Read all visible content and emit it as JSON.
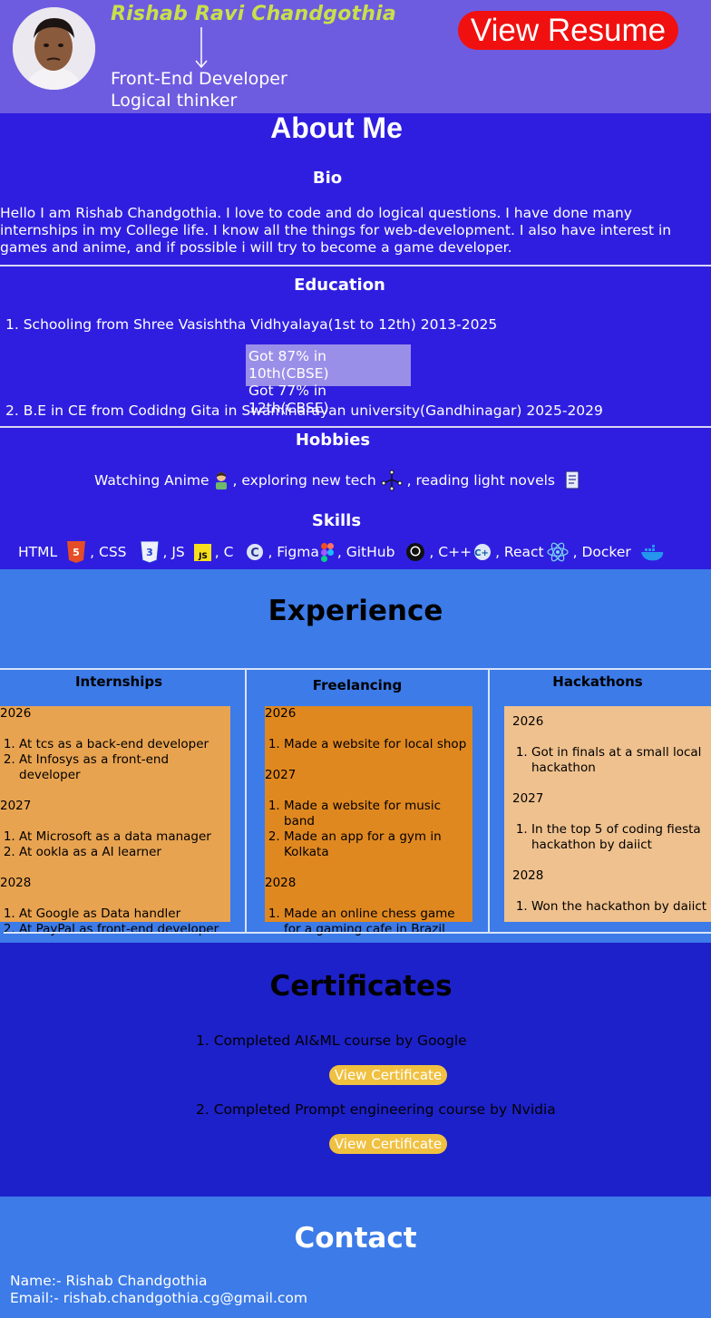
{
  "header": {
    "name": "Rishab Ravi Chandgothia",
    "roles": [
      "Front-End Developer",
      "Logical thinker"
    ],
    "resume_button": "View Resume"
  },
  "about": {
    "title": "About Me",
    "bio_heading": "Bio",
    "bio_text": "Hello I am Rishab Chandgothia. I love to code and do logical questions. I have done many internships in my College life. I know all the things for web-development. I also have interest in games and anime, and if possible i will try to become a game developer.",
    "education_heading": "Education",
    "education": [
      "1. Schooling from Shree Vasishtha Vidhyalaya(1st to 12th) 2013-2025",
      "2. B.E in CE from Codidng Gita in Swaminarayan university(Gandhinagar) 2025-2029"
    ],
    "grades": [
      "Got 87% in 10th(CBSE)",
      "Got 77% in 12th(CBSE)"
    ],
    "hobbies_heading": "Hobbies",
    "hobbies": [
      "Watching Anime",
      ", exploring new tech",
      ", reading light novels"
    ],
    "skills_heading": "Skills",
    "skills": [
      "HTML",
      ", CSS",
      ", JS",
      ", C",
      ", Figma",
      ", GitHub",
      ", C++",
      ", React",
      ", Docker"
    ]
  },
  "experience": {
    "title": "Experience",
    "internships": {
      "heading": "Internships",
      "years": [
        {
          "year": "2026",
          "items": [
            "At tcs as a back-end developer",
            "At Infosys as a front-end developer"
          ]
        },
        {
          "year": "2027",
          "items": [
            "At Microsoft as a data manager",
            "At ookla as a AI learner"
          ]
        },
        {
          "year": "2028",
          "items": [
            "At Google as Data handler",
            "At PayPal as front-end developer"
          ]
        }
      ]
    },
    "freelancing": {
      "heading": "Freelancing",
      "years": [
        {
          "year": "2026",
          "items": [
            "Made a website for local shop"
          ]
        },
        {
          "year": "2027",
          "items": [
            "Made a website for music band",
            "Made an app for a gym in Kolkata"
          ]
        },
        {
          "year": "2028",
          "items": [
            "Made an online chess game for a gaming cafe in Brazil"
          ]
        }
      ]
    },
    "hackathons": {
      "heading": "Hackathons",
      "years": [
        {
          "year": "2026",
          "items": [
            "Got in finals at a small local hackathon"
          ]
        },
        {
          "year": "2027",
          "items": [
            "In the top 5 of coding fiesta hackathon by daiict"
          ]
        },
        {
          "year": "2028",
          "items": [
            "Won the hackathon by daiict"
          ]
        }
      ]
    }
  },
  "certificates": {
    "title": "Certificates",
    "items": [
      {
        "label": "1. Completed AI&ML course by Google",
        "button": "View Certificate"
      },
      {
        "label": "2. Completed Prompt engineering course by Nvidia",
        "button": "View Certificate"
      }
    ]
  },
  "contact": {
    "title": "Contact",
    "name_line": "Name:- Rishab Chandgothia",
    "email_line": "Email:- rishab.chandgothia.cg@gmail.com"
  },
  "colors": {
    "header_bg": "#6d5ce0",
    "about_bg": "#2f1ee0",
    "experience_bg": "#3c7be8",
    "certificates_bg": "#1d21c9",
    "resume_button": "#f01010",
    "name_color": "#c9e04a",
    "certificate_button": "#f0c040",
    "internships_card": "#e8a350",
    "freelancing_card": "#e08820",
    "hackathons_card": "#efc18e"
  }
}
